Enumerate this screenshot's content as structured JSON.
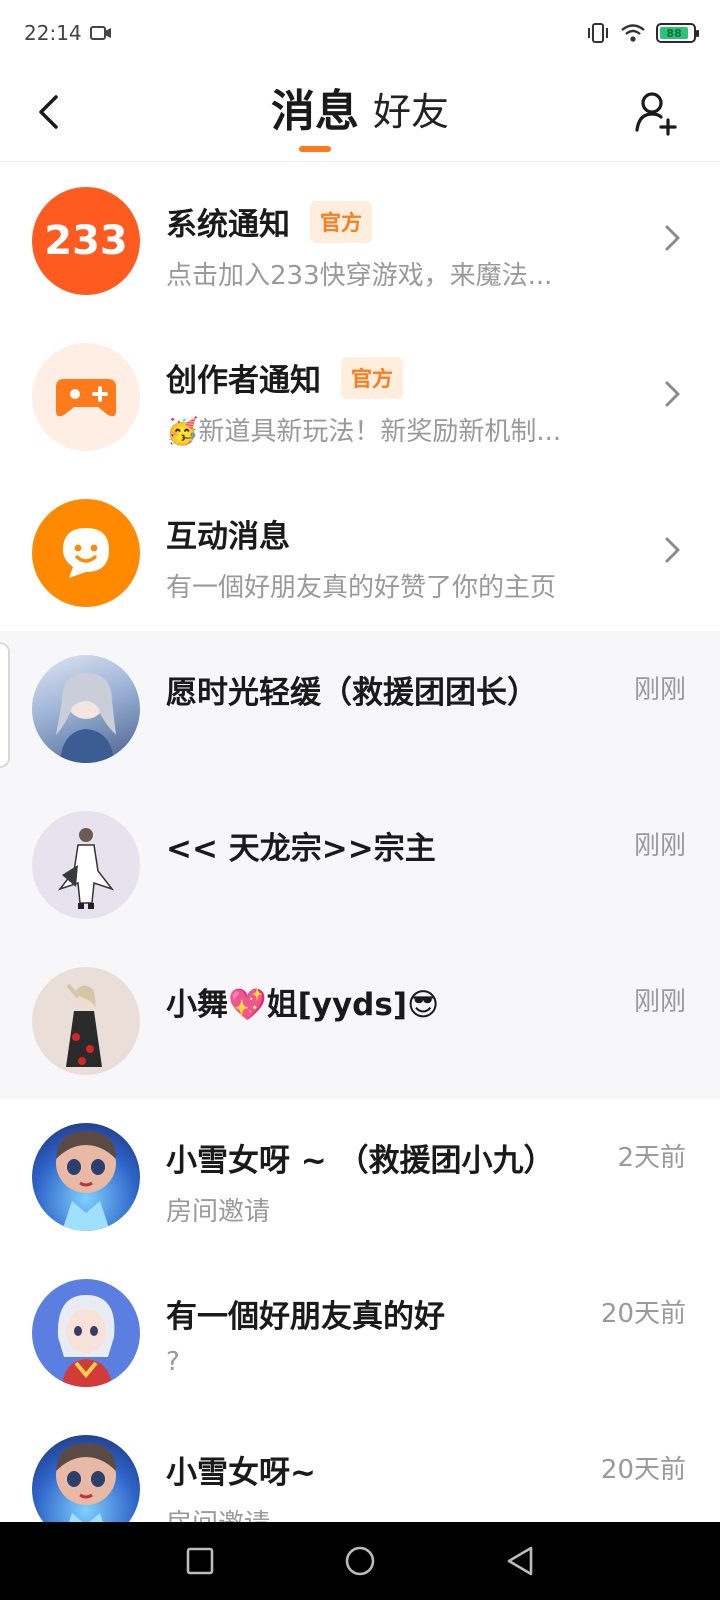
{
  "status_bar": {
    "time": "22:14",
    "battery_level": "88",
    "battery_fraction": 0.88
  },
  "header": {
    "tabs": [
      {
        "label": "消息",
        "active": true
      },
      {
        "label": "好友",
        "active": false
      }
    ],
    "accent_color": "#ff7a1a"
  },
  "system_rows": [
    {
      "title": "系统通知",
      "badge": "官方",
      "subtitle": "点击加入233快穿游戏，来魔法...",
      "icon": "233-logo-icon",
      "avatar_text": "233",
      "color": "#ff5a1f"
    },
    {
      "title": "创作者通知",
      "badge": "官方",
      "subtitle": "🥳新道具新玩法！新奖励新机制...",
      "icon": "gamepad-icon",
      "color": "#ff7a1a"
    },
    {
      "title": "互动消息",
      "badge": "",
      "subtitle": "有一個好朋友真的好赞了你的主页",
      "icon": "chat-bubble-icon",
      "color": "#ff8a00"
    }
  ],
  "chat_rows": [
    {
      "name": "愿时光轻缓（救援团团长）",
      "time": "刚刚",
      "preview": "",
      "avatar_color": "#8fa8c8",
      "highlight": true
    },
    {
      "name": "<< 天龙宗>>宗主",
      "time": "刚刚",
      "preview": "",
      "avatar_color": "#e6e2ee",
      "highlight": true
    },
    {
      "name": "小舞💖姐[yyds]😎",
      "time": "刚刚",
      "preview": "",
      "avatar_color": "#eadfd8",
      "highlight": true
    },
    {
      "name": "小雪女呀 ~ （救援团小九）",
      "time": "2天前",
      "preview": "房间邀请",
      "avatar_color": "#3a6fd8",
      "highlight": false
    },
    {
      "name": "有一個好朋友真的好",
      "time": "20天前",
      "preview": "?",
      "avatar_color": "#5a7fe0",
      "highlight": false
    },
    {
      "name": "小雪女呀~",
      "time": "20天前",
      "preview": "房间邀请",
      "avatar_color": "#3a6fd8",
      "highlight": false
    }
  ]
}
